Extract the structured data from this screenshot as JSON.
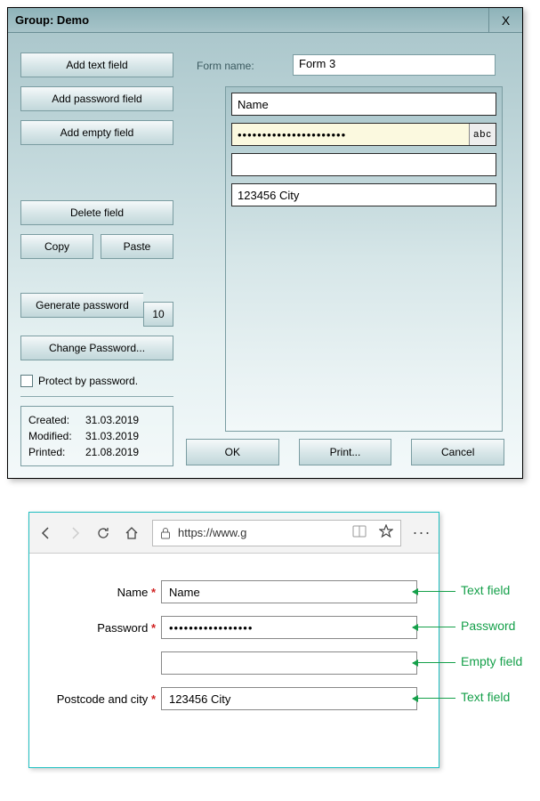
{
  "dialog": {
    "title": "Group: Demo",
    "close_label": "X",
    "buttons": {
      "add_text": "Add text field",
      "add_password": "Add password field",
      "add_empty": "Add empty field",
      "delete": "Delete field",
      "copy": "Copy",
      "paste": "Paste",
      "gen_pwd": "Generate password",
      "gen_len": "10",
      "change_pwd": "Change Password..."
    },
    "protect_label": "Protect by password.",
    "info": {
      "created_label": "Created:",
      "created_value": "31.03.2019",
      "modified_label": "Modified:",
      "modified_value": "31.03.2019",
      "printed_label": "Printed:",
      "printed_value": "21.08.2019"
    },
    "form_name_label": "Form name:",
    "form_name_value": "Form 3",
    "fields": {
      "name": "Name",
      "pwd_masked": "••••••••••••••••••••••",
      "abc": "abc",
      "empty": "",
      "city": "123456 City"
    },
    "actions": {
      "ok": "OK",
      "print": "Print...",
      "cancel": "Cancel"
    }
  },
  "browser": {
    "url": "https://www.g",
    "form": {
      "name_label": "Name",
      "name_value": "Name",
      "password_label": "Password",
      "password_value": "•••••••••••••••••",
      "empty_value": "",
      "postcode_label": "Postcode and city",
      "postcode_value": "123456 City"
    },
    "annotations": {
      "text_field": "Text field",
      "password": "Password",
      "empty_field": "Empty field",
      "text_field2": "Text field"
    }
  }
}
